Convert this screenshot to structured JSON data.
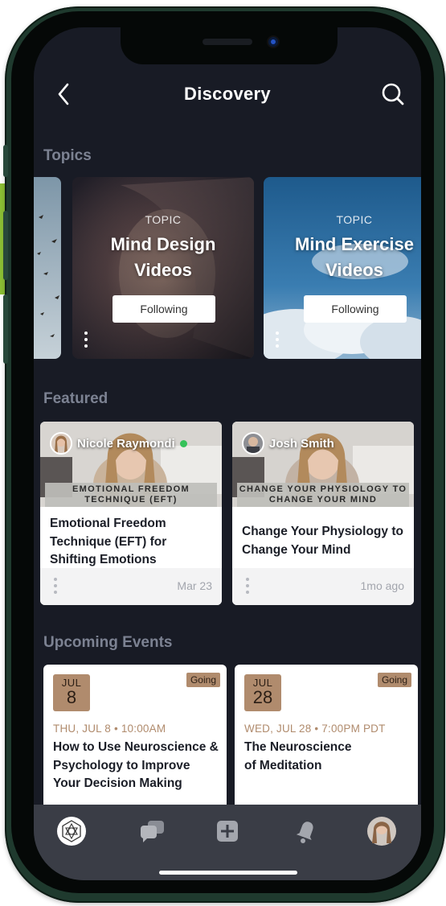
{
  "header": {
    "title": "Discovery"
  },
  "sections": {
    "topics": "Topics",
    "featured": "Featured",
    "upcoming": "Upcoming Events"
  },
  "topics": [
    {
      "label": "TOPIC",
      "name": "Mind Design Videos",
      "button": "Following"
    },
    {
      "label": "TOPIC",
      "name": "Mind Exercise Videos",
      "button": "Following"
    }
  ],
  "featured": [
    {
      "author": "Nicole Raymondi",
      "online": true,
      "banner": "EMOTIONAL FREEDOM TECHNIQUE (EFT)",
      "title": "Emotional Freedom Technique (EFT) for Shifting Emotions",
      "date": "Mar 23"
    },
    {
      "author": "Josh Smith",
      "online": false,
      "banner": "CHANGE YOUR PHYSIOLOGY TO CHANGE YOUR MIND",
      "title": "Change Your Physiology to Change Your Mind",
      "date": "1mo ago"
    }
  ],
  "events": [
    {
      "month": "JUL",
      "day": "8",
      "status": "Going",
      "when": "THU, JUL 8 • 10:00AM",
      "title": "How to Use Neuroscience & Psychology to Improve Your Decision Making"
    },
    {
      "month": "JUL",
      "day": "28",
      "status": "Going",
      "when": "WED, JUL 28 • 7:00PM PDT",
      "title": "The Neuroscience of Meditation"
    }
  ],
  "tabs": [
    "home-icon",
    "chat-icon",
    "add-icon",
    "bell-icon",
    "profile-avatar"
  ],
  "colors": {
    "background": "#181b25",
    "accent": "#b08b6d",
    "online": "#36c25a",
    "tabbar": "#3a3d46"
  }
}
